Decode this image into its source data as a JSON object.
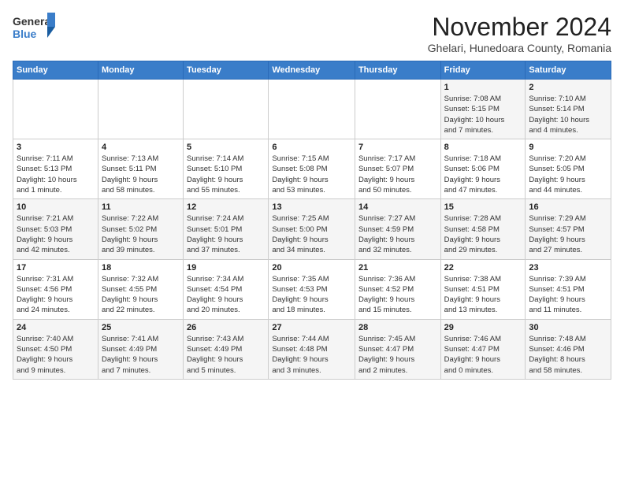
{
  "logo": {
    "line1": "General",
    "line2": "Blue"
  },
  "title": "November 2024",
  "subtitle": "Ghelari, Hunedoara County, Romania",
  "headers": [
    "Sunday",
    "Monday",
    "Tuesday",
    "Wednesday",
    "Thursday",
    "Friday",
    "Saturday"
  ],
  "weeks": [
    [
      {
        "day": "",
        "info": ""
      },
      {
        "day": "",
        "info": ""
      },
      {
        "day": "",
        "info": ""
      },
      {
        "day": "",
        "info": ""
      },
      {
        "day": "",
        "info": ""
      },
      {
        "day": "1",
        "info": "Sunrise: 7:08 AM\nSunset: 5:15 PM\nDaylight: 10 hours\nand 7 minutes."
      },
      {
        "day": "2",
        "info": "Sunrise: 7:10 AM\nSunset: 5:14 PM\nDaylight: 10 hours\nand 4 minutes."
      }
    ],
    [
      {
        "day": "3",
        "info": "Sunrise: 7:11 AM\nSunset: 5:13 PM\nDaylight: 10 hours\nand 1 minute."
      },
      {
        "day": "4",
        "info": "Sunrise: 7:13 AM\nSunset: 5:11 PM\nDaylight: 9 hours\nand 58 minutes."
      },
      {
        "day": "5",
        "info": "Sunrise: 7:14 AM\nSunset: 5:10 PM\nDaylight: 9 hours\nand 55 minutes."
      },
      {
        "day": "6",
        "info": "Sunrise: 7:15 AM\nSunset: 5:08 PM\nDaylight: 9 hours\nand 53 minutes."
      },
      {
        "day": "7",
        "info": "Sunrise: 7:17 AM\nSunset: 5:07 PM\nDaylight: 9 hours\nand 50 minutes."
      },
      {
        "day": "8",
        "info": "Sunrise: 7:18 AM\nSunset: 5:06 PM\nDaylight: 9 hours\nand 47 minutes."
      },
      {
        "day": "9",
        "info": "Sunrise: 7:20 AM\nSunset: 5:05 PM\nDaylight: 9 hours\nand 44 minutes."
      }
    ],
    [
      {
        "day": "10",
        "info": "Sunrise: 7:21 AM\nSunset: 5:03 PM\nDaylight: 9 hours\nand 42 minutes."
      },
      {
        "day": "11",
        "info": "Sunrise: 7:22 AM\nSunset: 5:02 PM\nDaylight: 9 hours\nand 39 minutes."
      },
      {
        "day": "12",
        "info": "Sunrise: 7:24 AM\nSunset: 5:01 PM\nDaylight: 9 hours\nand 37 minutes."
      },
      {
        "day": "13",
        "info": "Sunrise: 7:25 AM\nSunset: 5:00 PM\nDaylight: 9 hours\nand 34 minutes."
      },
      {
        "day": "14",
        "info": "Sunrise: 7:27 AM\nSunset: 4:59 PM\nDaylight: 9 hours\nand 32 minutes."
      },
      {
        "day": "15",
        "info": "Sunrise: 7:28 AM\nSunset: 4:58 PM\nDaylight: 9 hours\nand 29 minutes."
      },
      {
        "day": "16",
        "info": "Sunrise: 7:29 AM\nSunset: 4:57 PM\nDaylight: 9 hours\nand 27 minutes."
      }
    ],
    [
      {
        "day": "17",
        "info": "Sunrise: 7:31 AM\nSunset: 4:56 PM\nDaylight: 9 hours\nand 24 minutes."
      },
      {
        "day": "18",
        "info": "Sunrise: 7:32 AM\nSunset: 4:55 PM\nDaylight: 9 hours\nand 22 minutes."
      },
      {
        "day": "19",
        "info": "Sunrise: 7:34 AM\nSunset: 4:54 PM\nDaylight: 9 hours\nand 20 minutes."
      },
      {
        "day": "20",
        "info": "Sunrise: 7:35 AM\nSunset: 4:53 PM\nDaylight: 9 hours\nand 18 minutes."
      },
      {
        "day": "21",
        "info": "Sunrise: 7:36 AM\nSunset: 4:52 PM\nDaylight: 9 hours\nand 15 minutes."
      },
      {
        "day": "22",
        "info": "Sunrise: 7:38 AM\nSunset: 4:51 PM\nDaylight: 9 hours\nand 13 minutes."
      },
      {
        "day": "23",
        "info": "Sunrise: 7:39 AM\nSunset: 4:51 PM\nDaylight: 9 hours\nand 11 minutes."
      }
    ],
    [
      {
        "day": "24",
        "info": "Sunrise: 7:40 AM\nSunset: 4:50 PM\nDaylight: 9 hours\nand 9 minutes."
      },
      {
        "day": "25",
        "info": "Sunrise: 7:41 AM\nSunset: 4:49 PM\nDaylight: 9 hours\nand 7 minutes."
      },
      {
        "day": "26",
        "info": "Sunrise: 7:43 AM\nSunset: 4:49 PM\nDaylight: 9 hours\nand 5 minutes."
      },
      {
        "day": "27",
        "info": "Sunrise: 7:44 AM\nSunset: 4:48 PM\nDaylight: 9 hours\nand 3 minutes."
      },
      {
        "day": "28",
        "info": "Sunrise: 7:45 AM\nSunset: 4:47 PM\nDaylight: 9 hours\nand 2 minutes."
      },
      {
        "day": "29",
        "info": "Sunrise: 7:46 AM\nSunset: 4:47 PM\nDaylight: 9 hours\nand 0 minutes."
      },
      {
        "day": "30",
        "info": "Sunrise: 7:48 AM\nSunset: 4:46 PM\nDaylight: 8 hours\nand 58 minutes."
      }
    ]
  ]
}
